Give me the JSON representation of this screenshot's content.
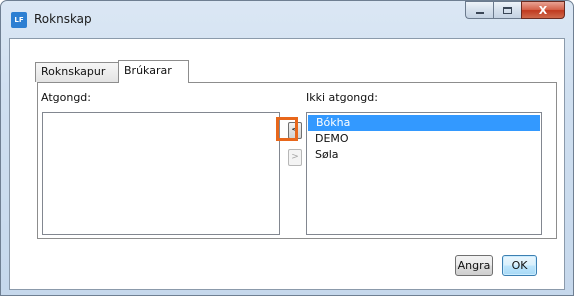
{
  "window": {
    "title": "Roknskap",
    "app_icon_label": "LF",
    "controls": {
      "minimize": "minimize",
      "maximize": "maximize",
      "close": "X"
    }
  },
  "tabs": [
    {
      "label": "Roknskapur",
      "active": false
    },
    {
      "label": "Brúkarar",
      "active": true
    }
  ],
  "panel": {
    "left_list": {
      "label": "Atgongd:",
      "items": []
    },
    "right_list": {
      "label": "Ikki atgongd:",
      "items": [
        {
          "label": "Bókha",
          "selected": true
        },
        {
          "label": "DEMO",
          "selected": false
        },
        {
          "label": "Søla",
          "selected": false
        }
      ]
    },
    "move_left_label": "<",
    "move_right_label": ">"
  },
  "buttons": {
    "cancel": "Angra",
    "ok": "OK"
  },
  "colors": {
    "selection": "#3399ff",
    "highlight_box": "#e8671b"
  }
}
